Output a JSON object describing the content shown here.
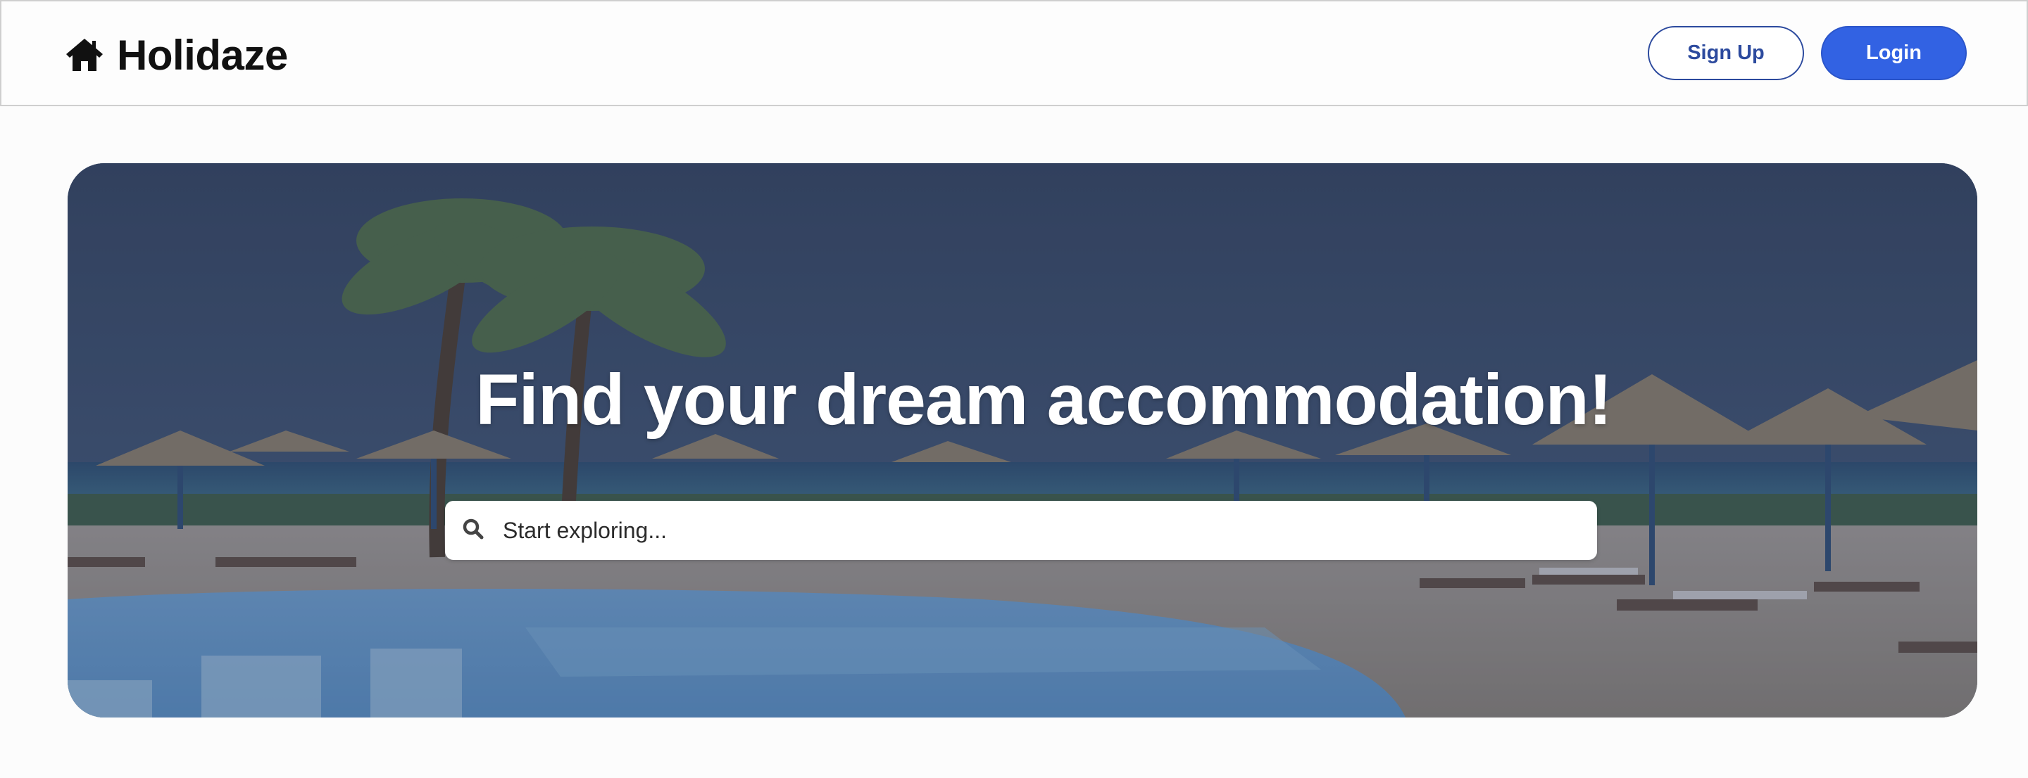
{
  "header": {
    "brand_icon": "home-icon",
    "brand_name": "Holidaze",
    "signup_label": "Sign Up",
    "login_label": "Login"
  },
  "hero": {
    "title": "Find your dream accommodation!",
    "background": "beach-resort-pool-palms-photo",
    "search": {
      "icon": "search-icon",
      "placeholder": "Start exploring..."
    }
  },
  "colors": {
    "accent": "#3262e3",
    "outline_button": "#2c4a9e",
    "page_bg": "#fcfcfc",
    "hero_overlay": "#2f4060"
  }
}
